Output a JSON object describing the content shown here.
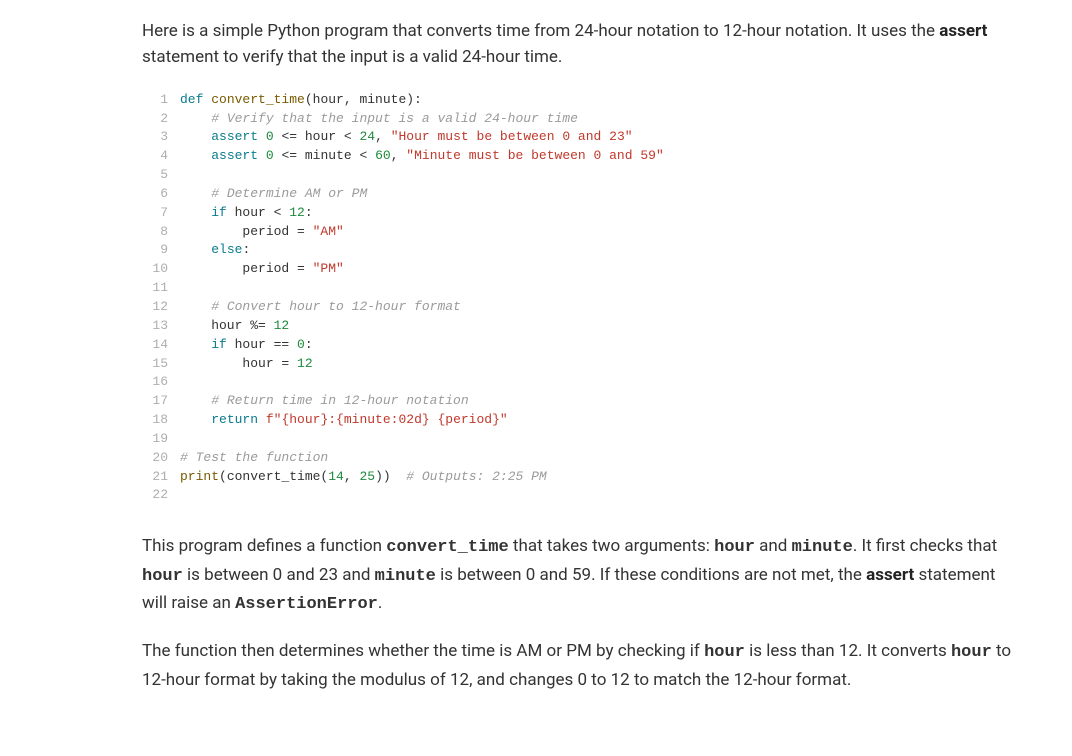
{
  "intro": {
    "line1_a": "Here is a simple Python program that converts time from 24-hour notation to 12-hour notation. It uses the ",
    "line1_b": "assert",
    "line1_c": " statement to verify that the input is a valid 24-hour time."
  },
  "code": {
    "lines": [
      {
        "n": "1",
        "seg": [
          [
            "kw",
            "def "
          ],
          [
            "fn",
            "convert_time"
          ],
          [
            "id",
            "(hour, minute):"
          ]
        ]
      },
      {
        "n": "2",
        "seg": [
          [
            "id",
            "    "
          ],
          [
            "com",
            "# Verify that the input is a valid 24-hour time"
          ]
        ]
      },
      {
        "n": "3",
        "seg": [
          [
            "id",
            "    "
          ],
          [
            "kw",
            "assert"
          ],
          [
            "id",
            " "
          ],
          [
            "num",
            "0"
          ],
          [
            "id",
            " <= hour < "
          ],
          [
            "num",
            "24"
          ],
          [
            "id",
            ", "
          ],
          [
            "str",
            "\"Hour must be between 0 and 23\""
          ]
        ]
      },
      {
        "n": "4",
        "seg": [
          [
            "id",
            "    "
          ],
          [
            "kw",
            "assert"
          ],
          [
            "id",
            " "
          ],
          [
            "num",
            "0"
          ],
          [
            "id",
            " <= minute < "
          ],
          [
            "num",
            "60"
          ],
          [
            "id",
            ", "
          ],
          [
            "str",
            "\"Minute must be between 0 and 59\""
          ]
        ]
      },
      {
        "n": "5",
        "seg": [
          [
            "id",
            ""
          ]
        ]
      },
      {
        "n": "6",
        "seg": [
          [
            "id",
            "    "
          ],
          [
            "com",
            "# Determine AM or PM"
          ]
        ]
      },
      {
        "n": "7",
        "seg": [
          [
            "id",
            "    "
          ],
          [
            "kw",
            "if"
          ],
          [
            "id",
            " hour < "
          ],
          [
            "num",
            "12"
          ],
          [
            "id",
            ":"
          ]
        ]
      },
      {
        "n": "8",
        "seg": [
          [
            "id",
            "        period = "
          ],
          [
            "str",
            "\"AM\""
          ]
        ]
      },
      {
        "n": "9",
        "seg": [
          [
            "id",
            "    "
          ],
          [
            "kw",
            "else"
          ],
          [
            "id",
            ":"
          ]
        ]
      },
      {
        "n": "10",
        "seg": [
          [
            "id",
            "        period = "
          ],
          [
            "str",
            "\"PM\""
          ]
        ]
      },
      {
        "n": "11",
        "seg": [
          [
            "id",
            ""
          ]
        ]
      },
      {
        "n": "12",
        "seg": [
          [
            "id",
            "    "
          ],
          [
            "com",
            "# Convert hour to 12-hour format"
          ]
        ]
      },
      {
        "n": "13",
        "seg": [
          [
            "id",
            "    hour %= "
          ],
          [
            "num",
            "12"
          ]
        ]
      },
      {
        "n": "14",
        "seg": [
          [
            "id",
            "    "
          ],
          [
            "kw",
            "if"
          ],
          [
            "id",
            " hour == "
          ],
          [
            "num",
            "0"
          ],
          [
            "id",
            ":"
          ]
        ]
      },
      {
        "n": "15",
        "seg": [
          [
            "id",
            "        hour = "
          ],
          [
            "num",
            "12"
          ]
        ]
      },
      {
        "n": "16",
        "seg": [
          [
            "id",
            ""
          ]
        ]
      },
      {
        "n": "17",
        "seg": [
          [
            "id",
            "    "
          ],
          [
            "com",
            "# Return time in 12-hour notation"
          ]
        ]
      },
      {
        "n": "18",
        "seg": [
          [
            "id",
            "    "
          ],
          [
            "kw",
            "return"
          ],
          [
            "id",
            " "
          ],
          [
            "str",
            "f\"{hour}:{minute:02d} {period}\""
          ]
        ]
      },
      {
        "n": "19",
        "seg": [
          [
            "id",
            ""
          ]
        ]
      },
      {
        "n": "20",
        "seg": [
          [
            "com",
            "# Test the function"
          ]
        ]
      },
      {
        "n": "21",
        "seg": [
          [
            "builtin",
            "print"
          ],
          [
            "id",
            "(convert_time("
          ],
          [
            "num",
            "14"
          ],
          [
            "id",
            ", "
          ],
          [
            "num",
            "25"
          ],
          [
            "id",
            "))  "
          ],
          [
            "com",
            "# Outputs: 2:25 PM"
          ]
        ]
      },
      {
        "n": "22",
        "seg": [
          [
            "id",
            ""
          ]
        ]
      }
    ]
  },
  "para2": {
    "a": "This program defines a function ",
    "b": "convert_time",
    "c": " that takes two arguments: ",
    "d": "hour",
    "e": " and ",
    "f": "minute",
    "g": ". It first checks that ",
    "h": "hour",
    "i": " is between 0 and 23 and ",
    "j": "minute",
    "k": " is between 0 and 59. If these conditions are not met, the ",
    "l": "assert",
    "m": " statement will raise an ",
    "n": "AssertionError",
    "o": "."
  },
  "para3": {
    "a": "The function then determines whether the time is AM or PM by checking if ",
    "b": "hour",
    "c": " is less than 12. It converts ",
    "d": "hour",
    "e": " to 12-hour format by taking the modulus of 12, and changes 0 to 12 to match the 12-hour format."
  }
}
